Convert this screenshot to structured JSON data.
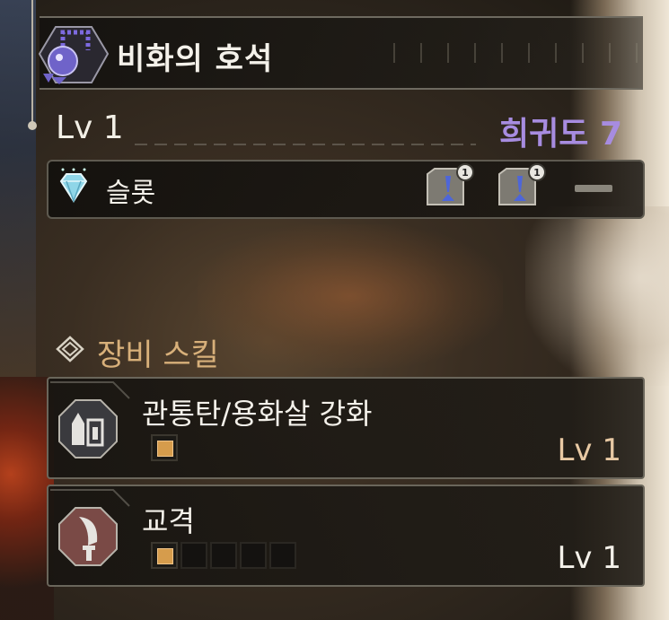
{
  "item": {
    "name": "비화의 호석",
    "level_label": "Lv 1",
    "rarity_label": "희귀도 7",
    "icon": "amulet-icon"
  },
  "slots": {
    "label": "슬롯",
    "icon": "gem-icon",
    "slot_levels": [
      1,
      1
    ],
    "empty_slot": true
  },
  "skills_section": {
    "title": "장비 스킬",
    "icon": "skill-emblem-icon"
  },
  "skills": [
    {
      "name": "관통탄/용화살 강화",
      "level_label": "Lv 1",
      "level": 1,
      "max_level": 1,
      "icon": "ammo-icon",
      "level_color": "#e8c9a4"
    },
    {
      "name": "교격",
      "level_label": "Lv 1",
      "level": 1,
      "max_level": 5,
      "icon": "blade-icon",
      "level_color": "#f4f1ea"
    }
  ],
  "colors": {
    "rarity": "#a78ce0",
    "section_title": "#d8b07a",
    "pip_filled": "#d69c4c"
  }
}
